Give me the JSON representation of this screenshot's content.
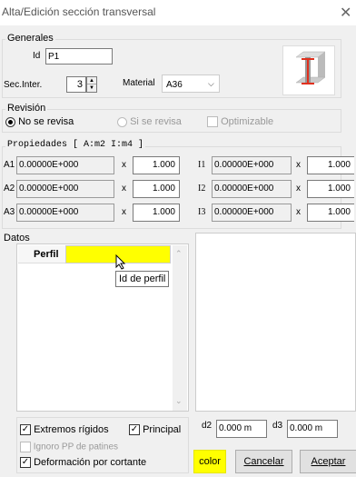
{
  "window": {
    "title": "Alta/Edición sección transversal",
    "close_glyph": "✕"
  },
  "generales": {
    "label": "Generales",
    "id_label": "Id",
    "id_value": "P1",
    "sec_inter_label": "Sec.Inter.",
    "sec_inter_value": "3",
    "material_label": "Material",
    "material_value": "A36",
    "icon": "i-beam-section-icon"
  },
  "revision": {
    "label": "Revisión",
    "options": [
      "No se revisa",
      "Si se revisa"
    ],
    "selected": "No se revisa",
    "optimizable_label": "Optimizable"
  },
  "propiedades": {
    "label": "Propiedades  [ A:m2  I:m4 ]",
    "x_label": "x",
    "areas": [
      {
        "name": "A1",
        "value": "0.00000E+000",
        "factor": "1.000"
      },
      {
        "name": "A2",
        "value": "0.00000E+000",
        "factor": "1.000"
      },
      {
        "name": "A3",
        "value": "0.00000E+000",
        "factor": "1.000"
      }
    ],
    "inertias": [
      {
        "name": "I1",
        "value": "0.00000E+000",
        "factor": "1.000"
      },
      {
        "name": "I2",
        "value": "0.00000E+000",
        "factor": "1.000"
      },
      {
        "name": "I3",
        "value": "0.00000E+000",
        "factor": "1.000"
      }
    ]
  },
  "datos": {
    "label": "Datos",
    "perfil_label": "Perfil",
    "perfil_value": "",
    "tooltip": "Id de perfil",
    "highlight_color": "#ffff00"
  },
  "options": {
    "extremos_rigidos": "Extremos rígidos",
    "principal": "Principal",
    "ignoro_pp": "Ignoro PP de patines",
    "deformacion": "Deformación por cortante"
  },
  "dims": {
    "d2_label": "d2",
    "d2_value": "0.000 m",
    "d3_label": "d3",
    "d3_value": "0.000 m"
  },
  "buttons": {
    "color": "color",
    "cancelar": "Cancelar",
    "aceptar": "Aceptar"
  },
  "colors": {
    "accent_yellow": "#ffff00",
    "beam_red": "#e0301e"
  }
}
